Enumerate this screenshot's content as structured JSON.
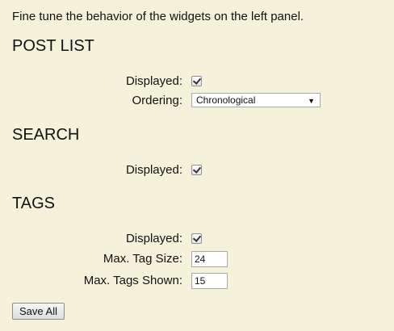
{
  "intro": "Fine tune the behavior of the widgets on the left panel.",
  "sections": {
    "post_list": {
      "title": "POST LIST",
      "displayed_label": "Displayed:",
      "displayed_checked": true,
      "ordering_label": "Ordering:",
      "ordering_value": "Chronological"
    },
    "search": {
      "title": "SEARCH",
      "displayed_label": "Displayed:",
      "displayed_checked": true
    },
    "tags": {
      "title": "TAGS",
      "displayed_label": "Displayed:",
      "displayed_checked": true,
      "max_tag_size_label": "Max. Tag Size:",
      "max_tag_size_value": "24",
      "max_tags_shown_label": "Max. Tags Shown:",
      "max_tags_shown_value": "15"
    }
  },
  "save_label": "Save All",
  "icons": {
    "checkbox": "checkmark-icon",
    "dropdown_arrow": "chevron-down-icon"
  }
}
